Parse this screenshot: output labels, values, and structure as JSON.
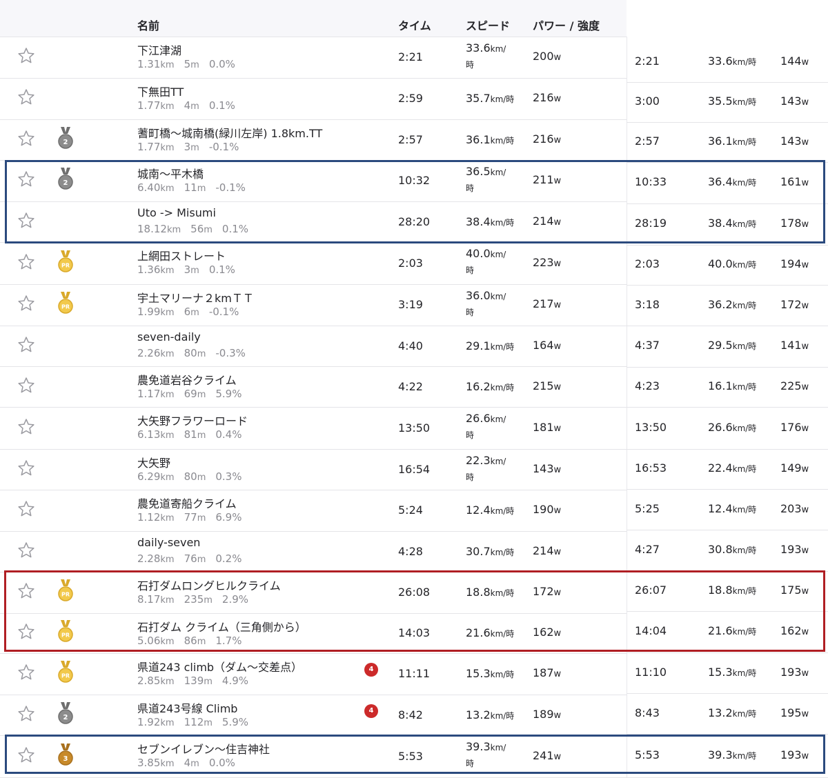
{
  "header": {
    "name": "名前",
    "time": "タイム",
    "speed": "スピード",
    "power": "パワー / 強度"
  },
  "colors": {
    "blue_box": "#2b4a7e",
    "red_box": "#b01e23",
    "silver_medal": "#8c8c8c",
    "gold_pr": "#f2c94c",
    "bronze_medal": "#c88a2a",
    "rank_badge": "#cc2a2a"
  },
  "rows": [
    {
      "name": "下江津湖",
      "dist": "1.31",
      "elev": "5",
      "grade": "0.0%",
      "medal": "",
      "rank": "",
      "time": "2:21",
      "speed": "33.6",
      "speed_wrap": true,
      "power": "200",
      "rtime": "2:21",
      "rspeed": "33.6",
      "rpower": "144"
    },
    {
      "name": "下無田TT",
      "dist": "1.77",
      "elev": "4",
      "grade": "0.1%",
      "medal": "",
      "rank": "",
      "time": "2:59",
      "speed": "35.7",
      "speed_wrap": false,
      "power": "216",
      "rtime": "3:00",
      "rspeed": "35.5",
      "rpower": "143"
    },
    {
      "name": "蓍町橋～城南橋(緑川左岸) 1.8km.TT",
      "dist": "1.77",
      "elev": "3",
      "grade": "-0.1%",
      "medal": "2",
      "rank": "",
      "time": "2:57",
      "speed": "36.1",
      "speed_wrap": false,
      "power": "216",
      "rtime": "2:57",
      "rspeed": "36.1",
      "rpower": "143"
    },
    {
      "name": "城南～平木橋",
      "dist": "6.40",
      "elev": "11",
      "grade": "-0.1%",
      "medal": "2",
      "rank": "",
      "time": "10:32",
      "speed": "36.5",
      "speed_wrap": true,
      "power": "211",
      "rtime": "10:33",
      "rspeed": "36.4",
      "rpower": "161"
    },
    {
      "name": "Uto -> Misumi",
      "dist": "18.12",
      "elev": "56",
      "grade": "0.1%",
      "medal": "",
      "rank": "",
      "time": "28:20",
      "speed": "38.4",
      "speed_wrap": false,
      "power": "214",
      "rtime": "28:19",
      "rspeed": "38.4",
      "rpower": "178"
    },
    {
      "name": "上網田ストレート",
      "dist": "1.36",
      "elev": "3",
      "grade": "0.1%",
      "medal": "PR",
      "rank": "",
      "time": "2:03",
      "speed": "40.0",
      "speed_wrap": true,
      "power": "223",
      "rtime": "2:03",
      "rspeed": "40.0",
      "rpower": "194"
    },
    {
      "name": "宇土マリーナ２kmＴＴ",
      "dist": "1.99",
      "elev": "6",
      "grade": "-0.1%",
      "medal": "PR",
      "rank": "",
      "time": "3:19",
      "speed": "36.0",
      "speed_wrap": true,
      "power": "217",
      "rtime": "3:18",
      "rspeed": "36.2",
      "rpower": "172"
    },
    {
      "name": "seven-daily",
      "dist": "2.26",
      "elev": "80",
      "grade": "-0.3%",
      "medal": "",
      "rank": "",
      "time": "4:40",
      "speed": "29.1",
      "speed_wrap": false,
      "power": "164",
      "rtime": "4:37",
      "rspeed": "29.5",
      "rpower": "141"
    },
    {
      "name": "農免道岩谷クライム",
      "dist": "1.17",
      "elev": "69",
      "grade": "5.9%",
      "medal": "",
      "rank": "",
      "time": "4:22",
      "speed": "16.2",
      "speed_wrap": false,
      "power": "215",
      "rtime": "4:23",
      "rspeed": "16.1",
      "rpower": "225"
    },
    {
      "name": "大矢野フラワーロード",
      "dist": "6.13",
      "elev": "81",
      "grade": "0.4%",
      "medal": "",
      "rank": "",
      "time": "13:50",
      "speed": "26.6",
      "speed_wrap": true,
      "power": "181",
      "rtime": "13:50",
      "rspeed": "26.6",
      "rpower": "176"
    },
    {
      "name": "大矢野",
      "dist": "6.29",
      "elev": "80",
      "grade": "0.3%",
      "medal": "",
      "rank": "",
      "time": "16:54",
      "speed": "22.3",
      "speed_wrap": true,
      "power": "143",
      "rtime": "16:53",
      "rspeed": "22.4",
      "rpower": "149"
    },
    {
      "name": "農免道寄船クライム",
      "dist": "1.12",
      "elev": "77",
      "grade": "6.9%",
      "medal": "",
      "rank": "",
      "time": "5:24",
      "speed": "12.4",
      "speed_wrap": false,
      "power": "190",
      "rtime": "5:25",
      "rspeed": "12.4",
      "rpower": "203"
    },
    {
      "name": "daily-seven",
      "dist": "2.28",
      "elev": "76",
      "grade": "0.2%",
      "medal": "",
      "rank": "",
      "time": "4:28",
      "speed": "30.7",
      "speed_wrap": false,
      "power": "214",
      "rtime": "4:27",
      "rspeed": "30.8",
      "rpower": "193"
    },
    {
      "name": "石打ダムロングヒルクライム",
      "dist": "8.17",
      "elev": "235",
      "grade": "2.9%",
      "medal": "PR",
      "rank": "",
      "time": "26:08",
      "speed": "18.8",
      "speed_wrap": false,
      "power": "172",
      "rtime": "26:07",
      "rspeed": "18.8",
      "rpower": "175"
    },
    {
      "name": "石打ダム クライム（三角側から）",
      "dist": "5.06",
      "elev": "86",
      "grade": "1.7%",
      "medal": "PR",
      "rank": "",
      "time": "14:03",
      "speed": "21.6",
      "speed_wrap": false,
      "power": "162",
      "rtime": "14:04",
      "rspeed": "21.6",
      "rpower": "162"
    },
    {
      "name": "県道243 climb（ダム～交差点）",
      "dist": "2.85",
      "elev": "139",
      "grade": "4.9%",
      "medal": "PR",
      "rank": "4",
      "time": "11:11",
      "speed": "15.3",
      "speed_wrap": false,
      "power": "187",
      "rtime": "11:10",
      "rspeed": "15.3",
      "rpower": "193"
    },
    {
      "name": "県道243号線 Climb",
      "dist": "1.92",
      "elev": "112",
      "grade": "5.9%",
      "medal": "2",
      "rank": "4",
      "time": "8:42",
      "speed": "13.2",
      "speed_wrap": false,
      "power": "189",
      "rtime": "8:43",
      "rspeed": "13.2",
      "rpower": "195"
    },
    {
      "name": "セブンイレブン～住吉神社",
      "dist": "3.85",
      "elev": "4",
      "grade": "0.0%",
      "medal": "3",
      "rank": "",
      "time": "5:53",
      "speed": "39.3",
      "speed_wrap": true,
      "power": "241",
      "rtime": "5:53",
      "rspeed": "39.3",
      "rpower": "193"
    }
  ],
  "units": {
    "km": "km",
    "m": "m",
    "speed": "km/時",
    "speed_a": "km/",
    "speed_b": "時",
    "watt": "w"
  }
}
